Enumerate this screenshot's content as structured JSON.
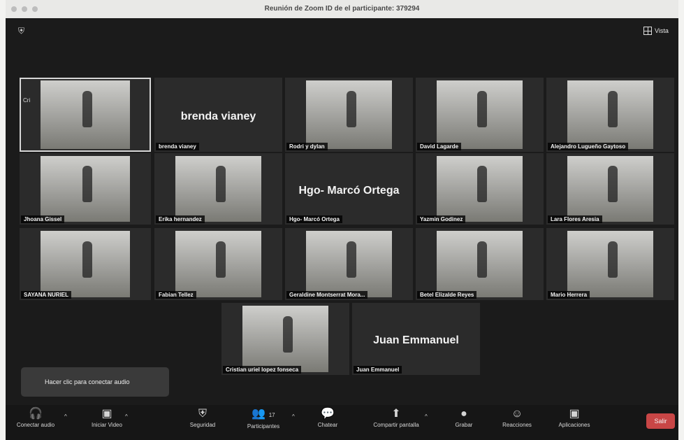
{
  "window": {
    "title": "Reunión de Zoom ID de el participante: 379294",
    "view_label": "Vista"
  },
  "participants": [
    {
      "name": "",
      "tag": "Cri",
      "active": true
    },
    {
      "name": "brenda vianey",
      "display": "brenda vianey"
    },
    {
      "name": "Rodri y dylan"
    },
    {
      "name": "David Lagarde"
    },
    {
      "name": "Alejandro Lugueño Gaytoso"
    },
    {
      "name": "Jhoana Gissel"
    },
    {
      "name": "Erika hernandez"
    },
    {
      "name": "Hgo- Marcó Ortega",
      "display": "Hgo- Marcó Ortega"
    },
    {
      "name": "Yazmin Godinez"
    },
    {
      "name": "Lara Flores Aresia"
    },
    {
      "name": "SAYANA NURIEL"
    },
    {
      "name": "Fabian Tellez"
    },
    {
      "name": "Geraldine Montserrat Mora..."
    },
    {
      "name": "Betel Elizalde Reyes"
    },
    {
      "name": "Mario Herrera"
    },
    {
      "name": "Cristian uriel lopez fonseca"
    },
    {
      "name": "Juan Emmanuel",
      "display": "Juan Emmanuel"
    }
  ],
  "audio_prompt": "Hacer clic para conectar audio",
  "toolbar": {
    "connect_audio": "Conectar audio",
    "start_video": "Iniciar Video",
    "security": "Seguridad",
    "participants": "Participantes",
    "participants_count": "17",
    "chat": "Chatear",
    "share_screen": "Compartir pantalla",
    "record": "Grabar",
    "reactions": "Reacciones",
    "apps": "Aplicaciones",
    "leave": "Salir"
  },
  "icons": {
    "shield": "shield-icon",
    "view": "grid-view-icon"
  },
  "colors": {
    "window_bg": "#1b1b1b",
    "toolbar_bg": "#161616",
    "leave_red": "#c84646"
  }
}
